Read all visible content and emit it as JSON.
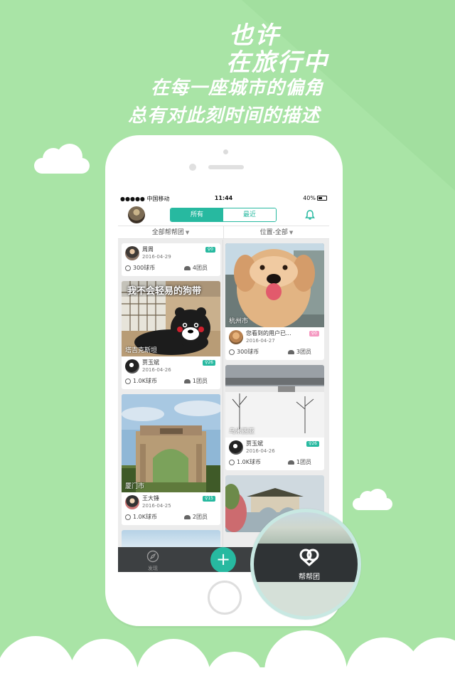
{
  "poster": {
    "line1": "也许",
    "line2": "在旅行中",
    "line3": "在每一座城市的偏角",
    "line4": "总有对此刻时间的描述"
  },
  "status_bar": {
    "carrier": "●●●●● 中国移动",
    "time": "11:44",
    "battery": "40%"
  },
  "top_bar": {
    "tabs": [
      {
        "label": "所有",
        "active": true
      },
      {
        "label": "最近",
        "active": false
      }
    ]
  },
  "filters": {
    "left": "全部帮帮团",
    "right": "位置-全部"
  },
  "left_column": [
    {
      "user": "周周",
      "date": "2016-04-29",
      "badge": "♀0",
      "coins": "300球币",
      "members": "4团员"
    },
    {
      "caption_overlay": "我不会轻易的狗带",
      "location": "塔吉克斯坦",
      "user": "贾玉斌",
      "date": "2016-04-26",
      "badge": "♀26",
      "coins": "1.0K球币",
      "members": "1团员"
    },
    {
      "location": "厦门市",
      "user": "王大锤",
      "date": "2016-04-25",
      "badge": "♀15",
      "coins": "1.0K球币",
      "members": "2团员"
    }
  ],
  "right_column": [
    {
      "location": "杭州市",
      "user": "您看到的用户已...",
      "date": "2016-04-27",
      "badge": "♀0",
      "coins": "300球币",
      "members": "3团员"
    },
    {
      "location": "乌米西亚",
      "user": "贾玉斌",
      "date": "2016-04-26",
      "badge": "♀26",
      "coins": "1.0K球币",
      "members": "1团员"
    }
  ],
  "tab_bar": {
    "discover": "发现",
    "add": "+",
    "group": "帮帮团"
  },
  "colors": {
    "accent": "#27b9a0",
    "background": "#a9e4a6",
    "badge_pink": "#f59ac2"
  }
}
